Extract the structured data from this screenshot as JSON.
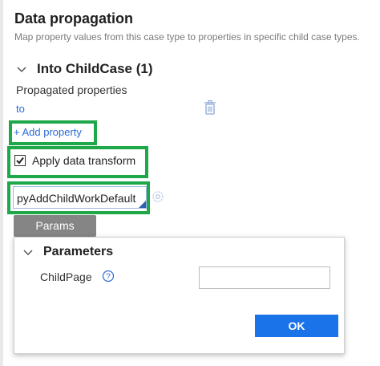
{
  "header": {
    "title": "Data propagation",
    "subtitle": "Map property values from this case type to properties in specific child case types."
  },
  "section": {
    "title": "Into ChildCase (1)",
    "properties_label": "Propagated properties",
    "property_value": "to",
    "add_property_label": "+ Add property"
  },
  "data_transform": {
    "checkbox_label": "Apply data transform",
    "checked": true,
    "value": "pyAddChildWorkDefault",
    "params_label": "Params"
  },
  "modal": {
    "title": "Parameters",
    "childpage_label": "ChildPage",
    "childpage_value": "",
    "ok_label": "OK"
  },
  "colors": {
    "highlight": "#1fa84a",
    "link": "#2a6bd4",
    "primary_button": "#1a73e8",
    "params_button": "#858585"
  },
  "icons": [
    "chevron-down-icon",
    "trash-icon",
    "checkbox-checked-icon",
    "gear-icon",
    "help-icon"
  ]
}
